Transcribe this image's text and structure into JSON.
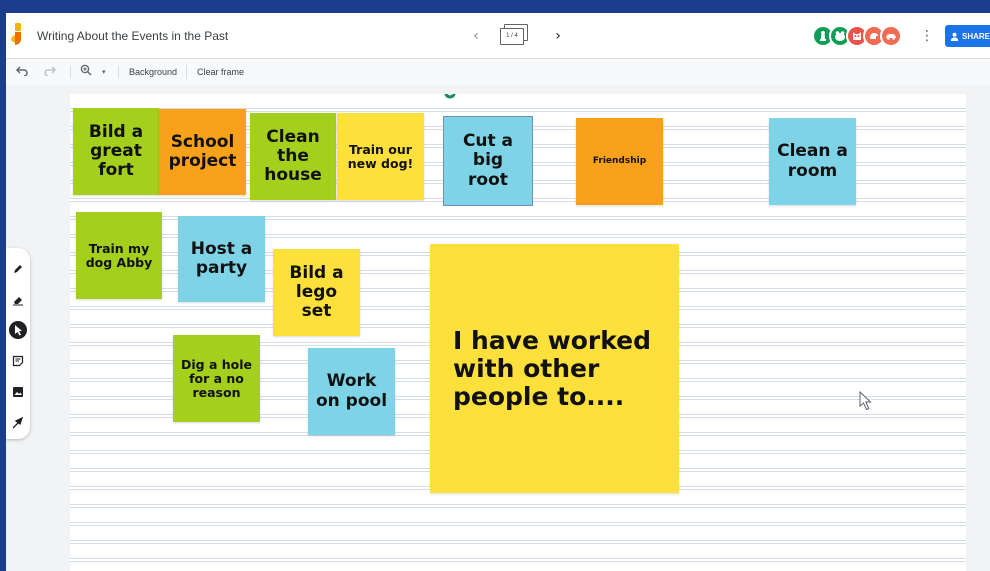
{
  "colors": {
    "green": "#a4cf1c",
    "orange": "#f9a11b",
    "yellow": "#fde03b",
    "blue": "#7fd3e6",
    "accent": "#1a73e8"
  },
  "header": {
    "logo_icon": "jamboard-logo-icon",
    "title": "Writing About the Events in the Past",
    "prev_icon": "chevron-left-icon",
    "frame_indicator": "1 / 4",
    "next_icon": "chevron-right-icon",
    "collaborators": [
      {
        "icon": "chess-piece-icon",
        "color": "#0f9d58"
      },
      {
        "icon": "frog-icon",
        "color": "#0f9d58"
      },
      {
        "icon": "owl-icon",
        "color": "#e8534a"
      },
      {
        "icon": "dragon-icon",
        "color": "#ef6c50"
      },
      {
        "icon": "car-icon",
        "color": "#ef6c50"
      }
    ],
    "more_icon": "more-vert-icon",
    "share_label": "SHARE"
  },
  "toolbar": {
    "undo_icon": "undo-icon",
    "redo_icon": "redo-icon",
    "zoom_icon": "zoom-icon",
    "zoom_dropdown_icon": "caret-down-icon",
    "background_label": "Background",
    "clear_frame_label": "Clear frame"
  },
  "tools": [
    {
      "name": "pen-tool",
      "icon": "pen-icon"
    },
    {
      "name": "eraser-tool",
      "icon": "eraser-icon"
    },
    {
      "name": "select-tool",
      "icon": "pointer-icon",
      "active": true
    },
    {
      "name": "sticky-note-tool",
      "icon": "sticky-note-icon"
    },
    {
      "name": "image-tool",
      "icon": "image-icon"
    },
    {
      "name": "laser-tool",
      "icon": "laser-icon"
    }
  ],
  "notes": [
    {
      "text": "Bild a great fort",
      "color": "green"
    },
    {
      "text": "School project",
      "color": "orange"
    },
    {
      "text": "Clean the house",
      "color": "green"
    },
    {
      "text": "Train our new dog!",
      "color": "yellow"
    },
    {
      "text": "Cut a big root",
      "color": "blue"
    },
    {
      "text": "Friendship",
      "color": "orange"
    },
    {
      "text": "Clean a room",
      "color": "blue"
    },
    {
      "text": "Train my dog Abby",
      "color": "green"
    },
    {
      "text": "Host a party",
      "color": "blue"
    },
    {
      "text": "Bild a lego set",
      "color": "yellow"
    },
    {
      "text": "Dig a hole for a no reason",
      "color": "green"
    },
    {
      "text": "Work on pool",
      "color": "blue"
    },
    {
      "text": "I have worked with other people to....",
      "color": "yellow"
    }
  ]
}
